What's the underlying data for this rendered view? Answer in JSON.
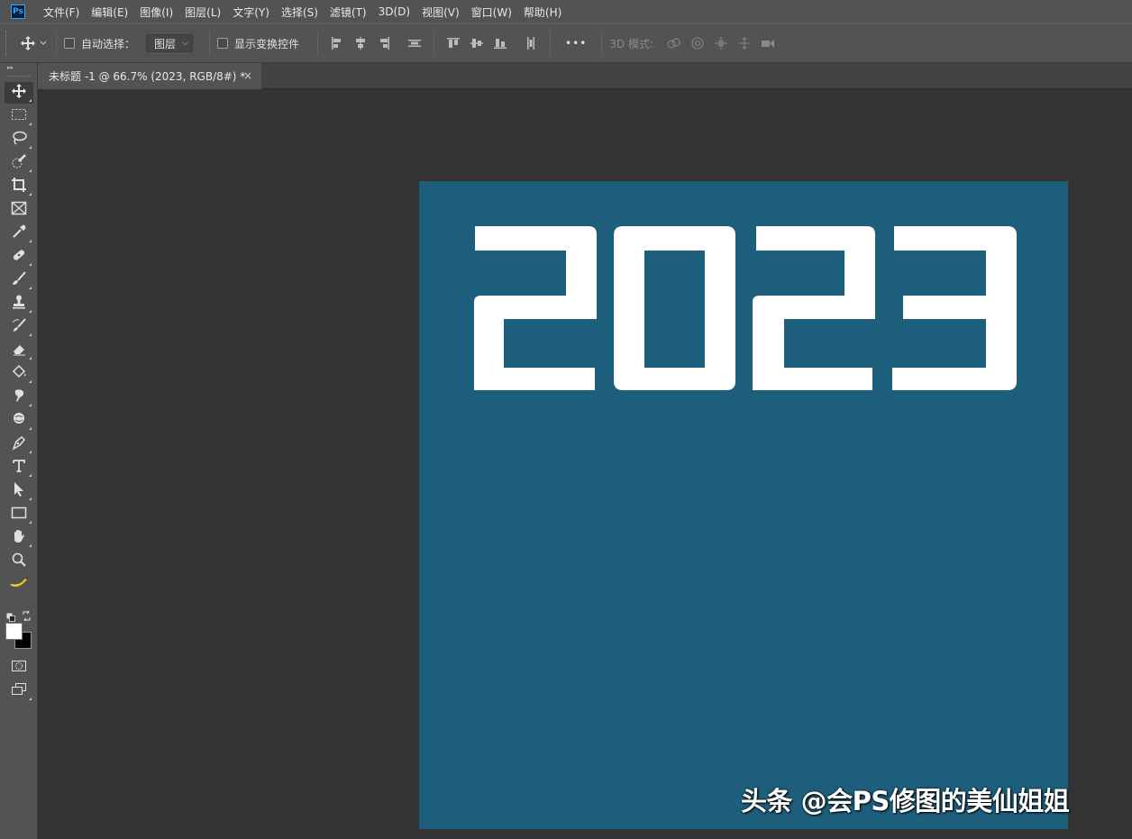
{
  "app": {
    "logo_text": "Ps"
  },
  "menu": [
    "文件(F)",
    "编辑(E)",
    "图像(I)",
    "图层(L)",
    "文字(Y)",
    "选择(S)",
    "滤镜(T)",
    "3D(D)",
    "视图(V)",
    "窗口(W)",
    "帮助(H)"
  ],
  "options": {
    "auto_select_label": "自动选择：",
    "auto_select_value": "图层",
    "show_transform_label": "显示变换控件",
    "mode_3d_label": "3D 模式:",
    "more_label": "•••"
  },
  "document": {
    "tab_title": "未标题 -1 @ 66.7% (2023, RGB/8#) *",
    "close_glyph": "×",
    "canvas_color": "#1d5e7c",
    "canvas_text": "2023"
  },
  "colors": {
    "foreground": "#ffffff",
    "background": "#000000"
  },
  "tools": [
    "move-icon",
    "marquee-icon",
    "lasso-icon",
    "quick-select-icon",
    "crop-icon",
    "frame-icon",
    "eyedropper-icon",
    "healing-icon",
    "brush-icon",
    "stamp-icon",
    "history-brush-icon",
    "eraser-icon",
    "paint-bucket-icon",
    "smudge-icon",
    "dodge-icon",
    "pen-icon",
    "type-icon",
    "path-select-icon",
    "rectangle-icon",
    "hand-icon",
    "zoom-icon",
    "banana-icon"
  ],
  "watermark": "头条 @会PS修图的美仙姐姐"
}
